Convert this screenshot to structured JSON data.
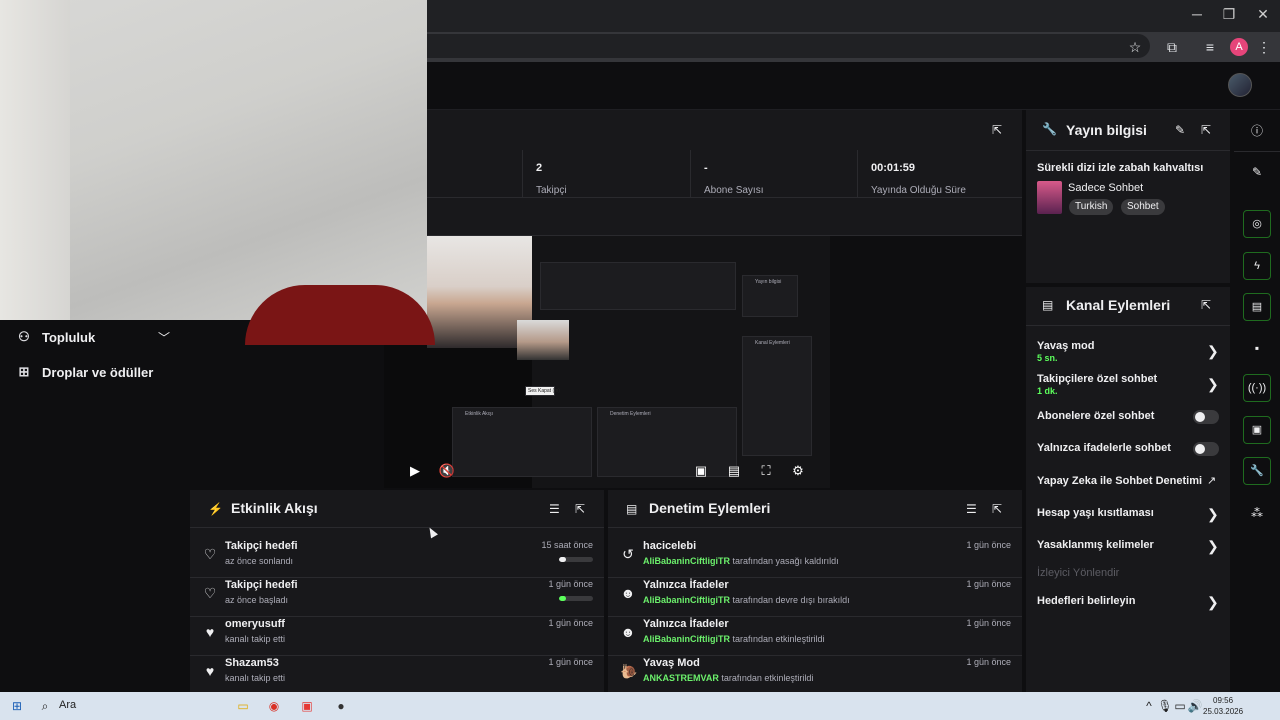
{
  "browser": {
    "controls": [
      "─",
      "❐",
      "✕"
    ],
    "profile_initial": "A"
  },
  "sidebar": {
    "items": [
      {
        "label": "Topluluk",
        "icon": "users-icon"
      },
      {
        "label": "Droplar ve ödüller",
        "icon": "gift-icon"
      }
    ]
  },
  "stats": [
    {
      "value": "2",
      "label": "Takipçi"
    },
    {
      "value": "-",
      "label": "Abone Sayısı"
    },
    {
      "value": "00:01:59",
      "label": "Yayında Olduğu Süre"
    }
  ],
  "activity_feed": {
    "title": "Etkinlik Akışı",
    "items": [
      {
        "title": "Takipçi hedefi",
        "sub": "az önce sonlandı",
        "time": "15 saat önce",
        "progress": 0.2,
        "progress_color": "#efeff1",
        "icon": "heart-outline-icon"
      },
      {
        "title": "Takipçi hedefi",
        "sub": "az önce başladı",
        "time": "1 gün önce",
        "progress": 0.2,
        "progress_color": "#5cff5c",
        "icon": "heart-outline-icon"
      },
      {
        "title": "omeryusuff",
        "sub": "kanalı takip etti",
        "time": "1 gün önce",
        "icon": "heart-icon"
      },
      {
        "title": "Shazam53",
        "sub": "kanalı takip etti",
        "time": "1 gün önce",
        "icon": "heart-icon"
      }
    ]
  },
  "mod_actions": {
    "title": "Denetim Eylemleri",
    "items": [
      {
        "title": "hacicelebi",
        "user": "AliBabaninCiftligiTR",
        "sub": "tarafından yasağı kaldırıldı",
        "time": "1 gün önce",
        "icon": "undo-icon"
      },
      {
        "title": "Yalnızca İfadeler",
        "user": "AliBabaninCiftligiTR",
        "sub": "tarafından devre dışı bırakıldı",
        "time": "1 gün önce",
        "icon": "emote-icon"
      },
      {
        "title": "Yalnızca İfadeler",
        "user": "AliBabaninCiftligiTR",
        "sub": "tarafından etkinleştirildi",
        "time": "1 gün önce",
        "icon": "emote-icon"
      },
      {
        "title": "Yavaş Mod",
        "user": "ANKASTREMVAR",
        "sub": "tarafından etkinleştirildi",
        "time": "1 gün önce",
        "icon": "snail-icon"
      }
    ]
  },
  "stream_info": {
    "title": "Yayın bilgisi",
    "stream_title": "Sürekli dizi izle zabah kahvaltısı",
    "category": "Sadece Sohbet",
    "tags": [
      "Turkish",
      "Sohbet"
    ]
  },
  "channel_actions": {
    "title": "Kanal Eylemleri",
    "rows": [
      {
        "label": "Yavaş mod",
        "sub": "5 sn.",
        "control": "chevron"
      },
      {
        "label": "Takipçilere özel sohbet",
        "sub": "1 dk.",
        "control": "chevron"
      },
      {
        "label": "Abonelere özel sohbet",
        "control": "toggle",
        "on": false
      },
      {
        "label": "Yalnızca ifadelerle sohbet",
        "control": "toggle",
        "on": false
      },
      {
        "label": "Yapay Zeka ile Sohbet Denetimi",
        "control": "external"
      },
      {
        "label": "Hesap yaşı kısıtlaması",
        "control": "chevron"
      },
      {
        "label": "Yasaklanmış kelimeler",
        "control": "chevron"
      },
      {
        "label": "İzleyici Yönlendir",
        "control": "none",
        "disabled": true
      },
      {
        "label": "Hedefleri belirleyin",
        "control": "chevron"
      }
    ]
  },
  "video_mini": {
    "panel_a": "Etkinlik Akışı",
    "panel_b": "Denetim Eylemleri",
    "side_a": "Yayın bilgisi",
    "side_b": "Kanal Eylemleri",
    "tooltip": "Ses Kapat (m)"
  },
  "taskbar": {
    "search": "Ara",
    "time": "09:56",
    "date": "25.03.2026"
  },
  "colors": {
    "accent_green": "#5cff5c",
    "panel_bg": "#18181b",
    "page_bg": "#0e0e10"
  }
}
